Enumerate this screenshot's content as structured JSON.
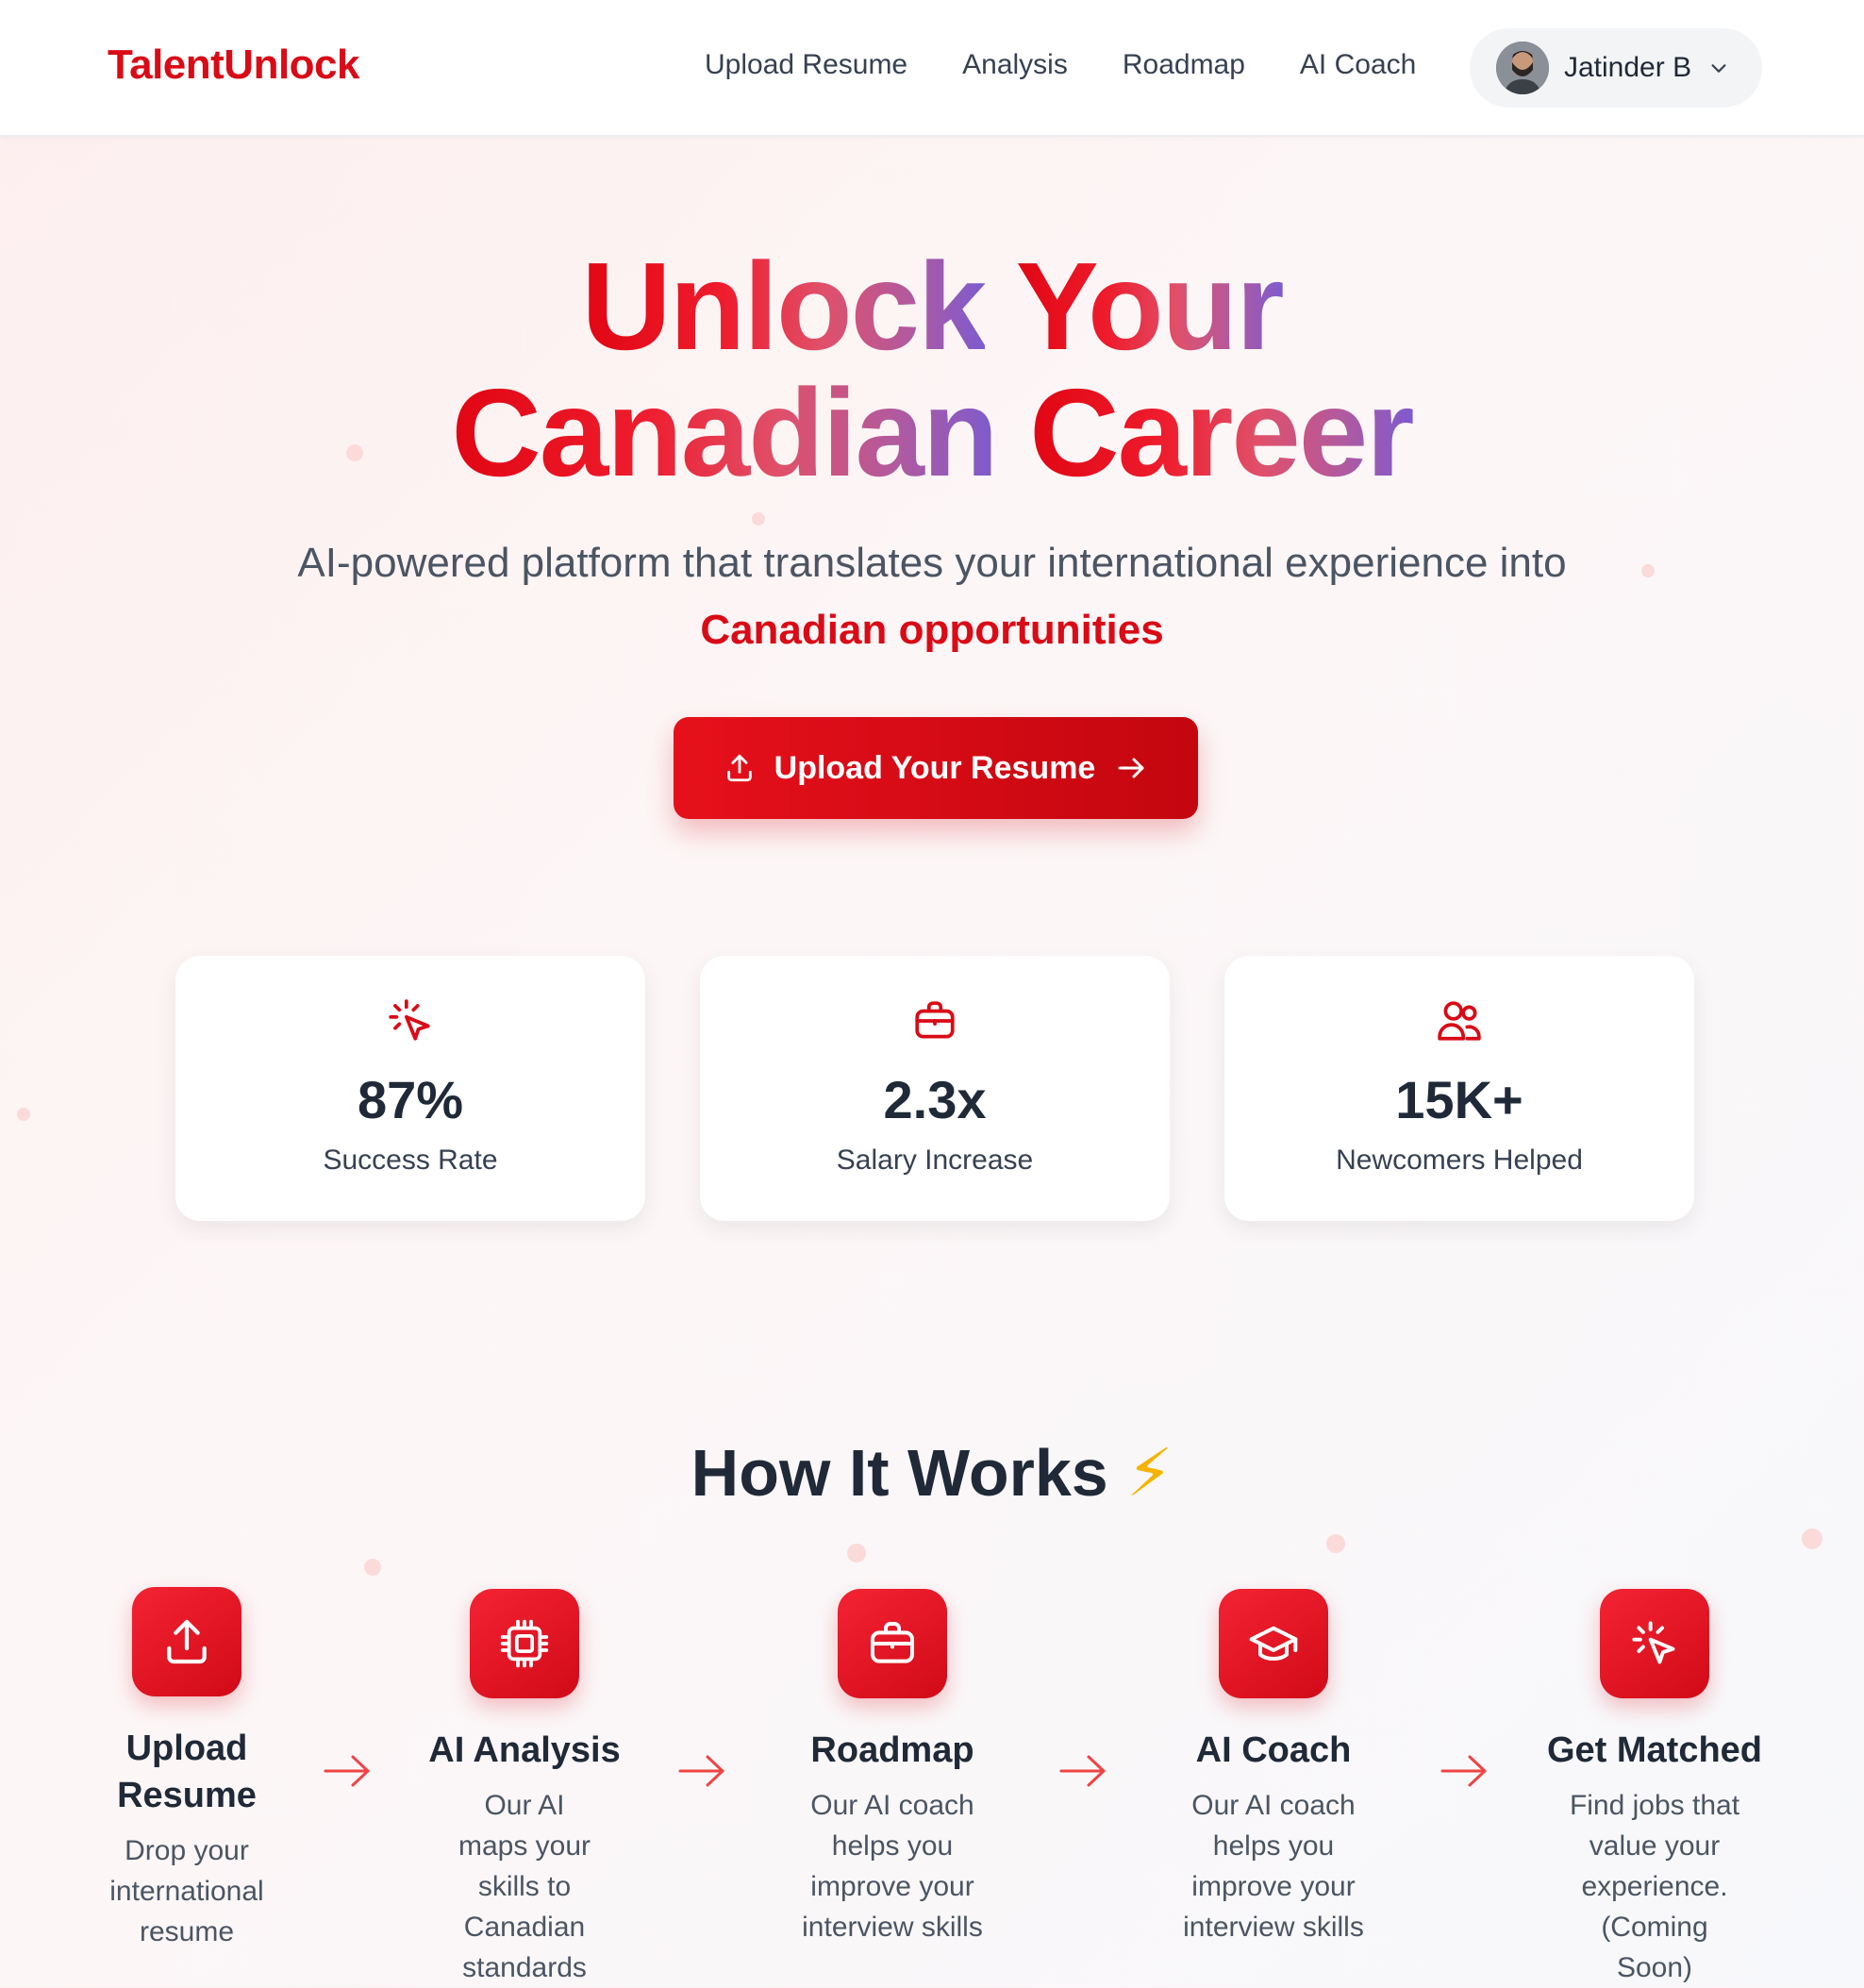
{
  "brand": "TalentUnlock",
  "nav": {
    "links": [
      "Upload Resume",
      "Analysis",
      "Roadmap",
      "AI Coach"
    ],
    "user_name": "Jatinder B"
  },
  "hero": {
    "title_word_1": "Unlock",
    "title_word_2": "Your",
    "title_word_3": "Canadian",
    "title_word_4": "Career",
    "subtitle": "AI-powered platform that translates your international experience into",
    "accent": "Canadian opportunities",
    "cta_label": "Upload Your Resume"
  },
  "stats": [
    {
      "icon": "cursor-click-icon",
      "value": "87%",
      "label": "Success Rate"
    },
    {
      "icon": "briefcase-icon",
      "value": "2.3x",
      "label": "Salary Increase"
    },
    {
      "icon": "users-icon",
      "value": "15K+",
      "label": "Newcomers Helped"
    }
  ],
  "how": {
    "title": "How It Works",
    "emoji": "⚡",
    "steps": [
      {
        "icon": "upload-icon",
        "title": "Upload Resume",
        "desc": "Drop your international resume"
      },
      {
        "icon": "cpu-chip-icon",
        "title": "AI Analysis",
        "desc": "Our AI maps your skills to Canadian standards"
      },
      {
        "icon": "briefcase-icon",
        "title": "Roadmap",
        "desc": "Our AI coach helps you improve your interview skills"
      },
      {
        "icon": "graduation-cap-icon",
        "title": "AI Coach",
        "desc": "Our AI coach helps you improve your interview skills"
      },
      {
        "icon": "cursor-click-icon",
        "title": "Get Matched",
        "desc": "Find jobs that value your experience. (Coming Soon)"
      }
    ]
  },
  "colors": {
    "accent": "#d90b16",
    "text": "#1f2937",
    "muted": "#4b5563"
  }
}
